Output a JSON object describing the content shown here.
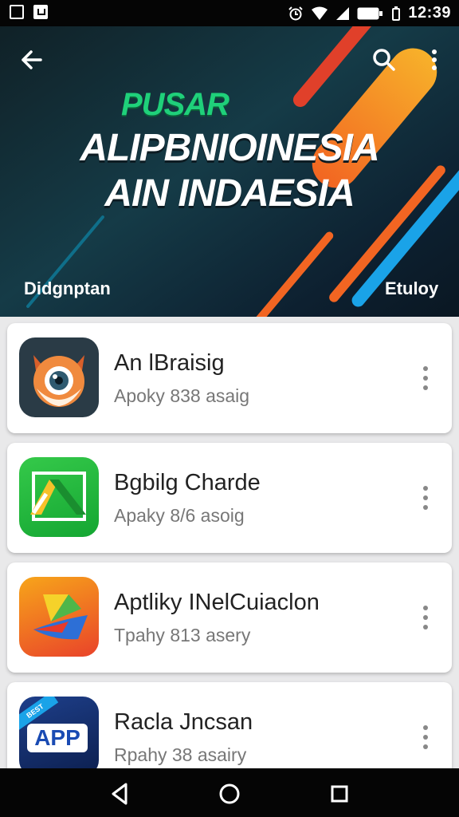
{
  "status_bar": {
    "time": "12:39"
  },
  "hero": {
    "tag": "PUSAR",
    "title_line1": "ALIPBNIOINESIA",
    "title_line2": "AIN INDAESIA",
    "left_label": "Didgnptan",
    "right_label": "Etuloy",
    "colors": {
      "background": "#153b47",
      "tag": "#1fd07a",
      "accent_orange": "#f26522",
      "accent_blue": "#1aa3e8"
    }
  },
  "apps": [
    {
      "name": "An lBraisig",
      "subtitle": "Apoky 838 asaig",
      "icon": "fox-eye-icon"
    },
    {
      "name": "Bgbilg Charde",
      "subtitle": "Apaky 8/6 asoig",
      "icon": "green-drive-icon"
    },
    {
      "name": "Aptliky INelCuiaclon",
      "subtitle": "Tpahy 813 asery",
      "icon": "colorful-fold-icon"
    },
    {
      "name": "Racla Jncsan",
      "subtitle": "Rpahy 38 asairy",
      "icon": "app-badge-icon",
      "badge": "APP",
      "ribbon": "BEST"
    }
  ]
}
